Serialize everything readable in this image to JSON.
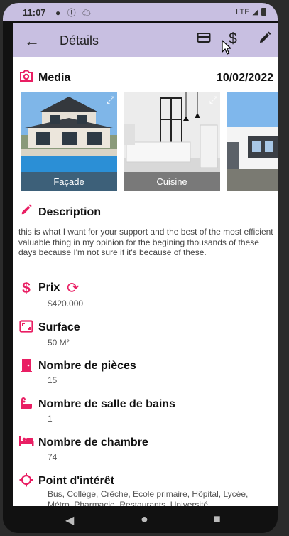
{
  "status": {
    "time": "11:07",
    "network": "LTE"
  },
  "appbar": {
    "title": "Détails"
  },
  "media": {
    "title": "Media",
    "date": "10/02/2022",
    "photos": [
      {
        "caption": "Façade"
      },
      {
        "caption": "Cuisine"
      },
      {
        "caption": ""
      }
    ]
  },
  "description": {
    "title": "Description",
    "text": "this is what I want for your support and the best of the most efficient valuable thing in my opinion for the begining thousands of these days because I'm not sure if it's because of these."
  },
  "price": {
    "title": "Prix",
    "value": "$420.000"
  },
  "surface": {
    "title": "Surface",
    "value": "50 M²"
  },
  "rooms": {
    "title": "Nombre de pièces",
    "value": "15"
  },
  "bathrooms": {
    "title": "Nombre de salle de bains",
    "value": "1"
  },
  "bedrooms": {
    "title": "Nombre de chambre",
    "value": "74"
  },
  "poi": {
    "title": "Point d'intérêt",
    "value": "Bus, Collège, Crêche, Ecole primaire, Hôpital, Lycée, Métro, Pharmacie, Restaurants, Université"
  }
}
